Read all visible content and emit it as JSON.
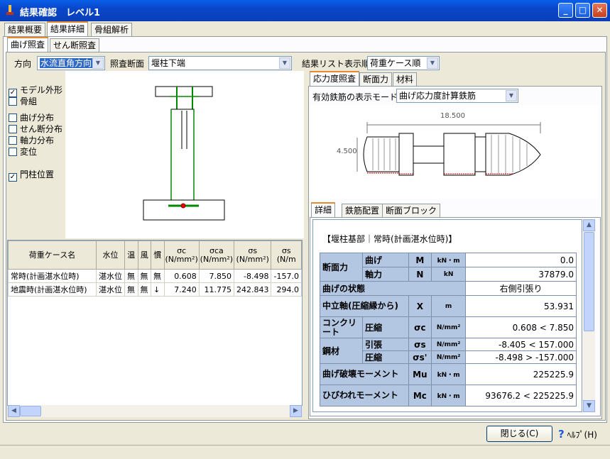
{
  "window": {
    "title": "結果確認　レベル1",
    "min": "_",
    "max": "□",
    "close": "✕"
  },
  "main_tabs": [
    "結果概要",
    "結果詳細",
    "骨組解析"
  ],
  "sub_tabs": [
    "曲げ照査",
    "せん断照査"
  ],
  "controls": {
    "direction_label": "方向",
    "direction_value": "水流直角方向",
    "section_label": "照査断面",
    "section_value": "堰柱下端",
    "order_label": "結果リスト表示順",
    "order_value": "荷重ケース順"
  },
  "checkboxes": [
    {
      "label": "モデル外形",
      "checked": true
    },
    {
      "label": "骨組",
      "checked": false
    },
    {
      "label": "曲げ分布",
      "checked": false
    },
    {
      "label": "せん断分布",
      "checked": false
    },
    {
      "label": "軸力分布",
      "checked": false
    },
    {
      "label": "変位",
      "checked": false
    },
    {
      "label": "門柱位置",
      "checked": true
    }
  ],
  "load_table": {
    "headers": [
      "荷重ケース名",
      "水位",
      "温",
      "風",
      "慣",
      "σc\n(N/mm²)",
      "σca\n(N/mm²)",
      "σs\n(N/mm²)",
      "σs\n(N/m"
    ],
    "rows": [
      [
        "常時(計画湛水位時)",
        "湛水位",
        "無",
        "無",
        "無",
        "0.608",
        "7.850",
        "-8.498",
        "-157.0"
      ],
      [
        "地震時(計画湛水位時)",
        "湛水位",
        "無",
        "無",
        "↓",
        "7.240",
        "11.775",
        "242.843",
        "294.0"
      ]
    ]
  },
  "right_tabs": [
    "応力度照査",
    "断面力",
    "材料"
  ],
  "rebar_mode_label": "有効鉄筋の表示モード",
  "rebar_mode_value": "曲げ応力度計算鉄筋",
  "section_dims": {
    "width": "18.500",
    "height": "4.500"
  },
  "detail_tabs": [
    "詳細",
    "鉄筋配置",
    "断面ブロック"
  ],
  "detail": {
    "heading": "【堰柱基部｜常時(計画湛水位時)】",
    "rows": [
      {
        "g": "断面力",
        "s": "曲げ",
        "sym": "M",
        "unit": "kN・m",
        "val": "0.0"
      },
      {
        "g": "",
        "s": "軸力",
        "sym": "N",
        "unit": "kN",
        "val": "37879.0"
      },
      {
        "g": "曲げの状態",
        "s": "",
        "sym": "",
        "unit": "",
        "val": "右側引張り"
      },
      {
        "g": "中立軸(圧縮縁から)",
        "s": "",
        "sym": "X",
        "unit": "m",
        "val": "53.931"
      },
      {
        "g": "コンクリート",
        "s": "圧縮",
        "sym": "σc",
        "unit": "N/mm²",
        "val": "0.608 < 7.850"
      },
      {
        "g": "鋼材",
        "s": "引張",
        "sym": "σs",
        "unit": "N/mm²",
        "val": "-8.405 < 157.000"
      },
      {
        "g": "",
        "s": "圧縮",
        "sym": "σs'",
        "unit": "N/mm²",
        "val": "-8.498 > -157.000"
      },
      {
        "g": "曲げ破壊モーメント",
        "s": "",
        "sym": "Mu",
        "unit": "kN・m",
        "val": "225225.9"
      },
      {
        "g": "ひびわれモーメント",
        "s": "",
        "sym": "Mc",
        "unit": "kN・m",
        "val": "93676.2 < 225225.9"
      }
    ]
  },
  "buttons": {
    "close": "閉じる(C)",
    "help": "ﾍﾙﾌﾟ(H)",
    "help_icon": "?"
  }
}
